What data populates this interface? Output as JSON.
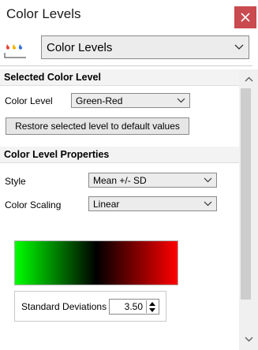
{
  "panel": {
    "title": "Color Levels",
    "mode": "Color Levels"
  },
  "selected_level": {
    "section_title": "Selected Color Level",
    "color_level_label": "Color Level",
    "color_level_value": "Green-Red",
    "restore_button": "Restore selected level to default values"
  },
  "properties": {
    "section_title": "Color Level Properties",
    "style_label": "Style",
    "style_value": "Mean +/- SD",
    "scaling_label": "Color Scaling",
    "scaling_value": "Linear"
  },
  "gradient": {
    "colors": [
      "#00ff00",
      "#000000",
      "#ff0000"
    ]
  },
  "sd": {
    "label": "Standard Deviations",
    "value": "3.50"
  },
  "icons": {
    "close": "close-icon",
    "app": "color-drops-icon",
    "dropdown": "chevron-down-icon",
    "scroll_up": "scroll-up-icon",
    "scroll_down": "scroll-down-icon"
  },
  "colors": {
    "close_bg": "#c94a4f",
    "section_bg": "#f3f3f3"
  },
  "scroll": {
    "thumb_fraction": 0.88
  }
}
